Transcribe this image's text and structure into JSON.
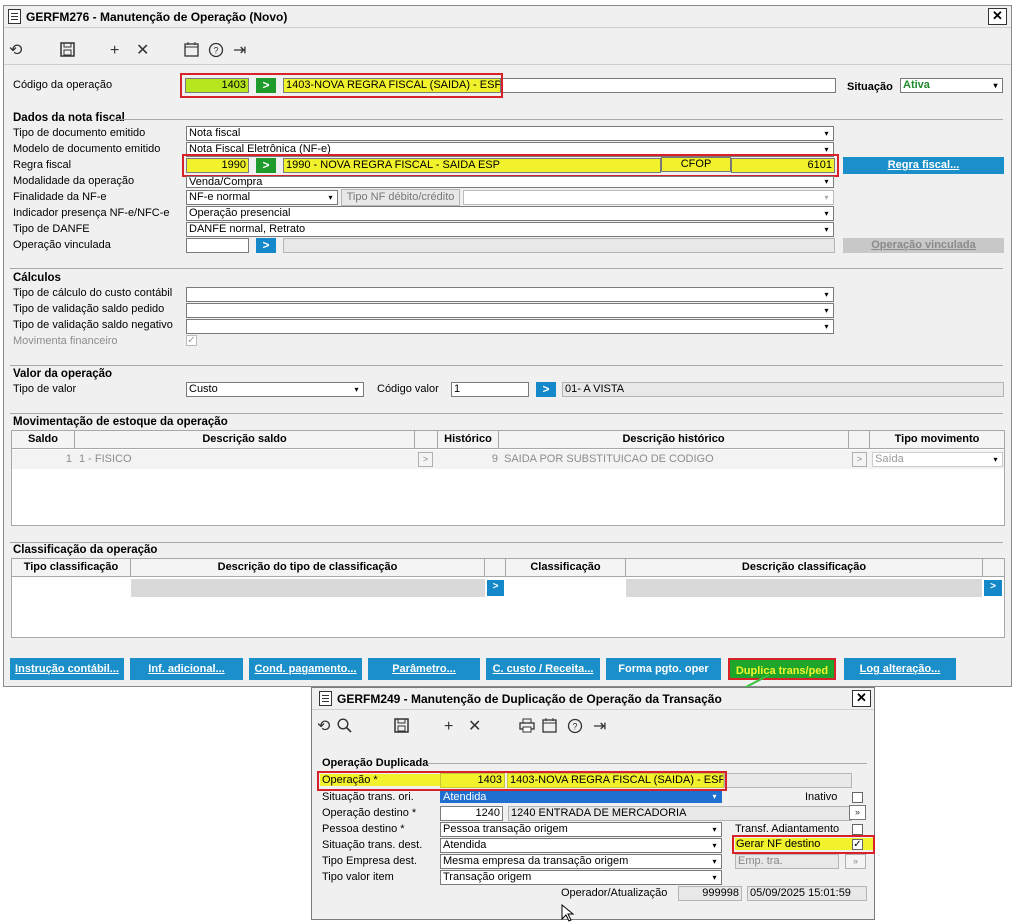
{
  "main": {
    "title": "GERFM276 - Manutenção de Operação (Novo)",
    "codigo_label": "Código da operação",
    "codigo_value": "1403",
    "codigo_desc": "1403-NOVA REGRA FISCAL (SAIDA) - ESP",
    "situacao_label": "Situação",
    "situacao_value": "Ativa",
    "section_nota": "Dados da nota fiscal",
    "tipo_doc_label": "Tipo de documento emitido",
    "tipo_doc_value": "Nota fiscal",
    "modelo_doc_label": "Modelo de documento emitido",
    "modelo_doc_value": "Nota Fiscal Eletrônica (NF-e)",
    "regra_label": "Regra fiscal",
    "regra_value": "1990",
    "regra_desc": "1990 - NOVA REGRA FISCAL - SAIDA ESP",
    "cfop_label": "CFOP",
    "cfop_value": "6101",
    "regra_btn": "Regra fiscal...",
    "modalidade_label": "Modalidade da operação",
    "modalidade_value": "Venda/Compra",
    "finalidade_label": "Finalidade da NF-e",
    "finalidade_value": "NF-e normal",
    "tipo_nf_btn": "Tipo NF débito/crédito",
    "indicador_label": "Indicador presença NF-e/NFC-e",
    "indicador_value": "Operação presencial",
    "danfe_label": "Tipo de DANFE",
    "danfe_value": "DANFE normal, Retrato",
    "op_vinculada_label": "Operação vinculada",
    "op_vinculada_btn": "Operação vinculada",
    "section_calculos": "Cálculos",
    "custo_label": "Tipo de cálculo do custo contábil",
    "saldo_pedido_label": "Tipo de validação saldo pedido",
    "saldo_negativo_label": "Tipo de validação saldo negativo",
    "mov_fin_label": "Movimenta financeiro",
    "section_valor": "Valor da operação",
    "tipo_valor_label": "Tipo de valor",
    "tipo_valor_value": "Custo",
    "codigo_valor_label": "Código valor",
    "codigo_valor_value": "1",
    "codigo_valor_desc": "01- A VISTA",
    "section_estoque": "Movimentação de estoque da operação",
    "estoque_headers": [
      "Saldo",
      "Descrição saldo",
      "Histórico",
      "Descrição histórico",
      "Tipo movimento"
    ],
    "estoque_row": {
      "saldo": "1",
      "descricao": "1 - FISICO",
      "historico": "9",
      "desc_historico": "SAIDA POR SUBSTITUICAO DE CODIGO",
      "tipo": "Saída"
    },
    "section_class": "Classificação da operação",
    "class_headers": [
      "Tipo classificação",
      "Descrição do tipo de classificação",
      "Classificação",
      "Descrição classificação"
    ],
    "buttons": [
      "Instrução contábil...",
      "Inf. adicional...",
      "Cond. pagamento...",
      "Parâmetro...",
      "C. custo / Receita...",
      "Forma pgto. oper",
      "Duplica trans/ped",
      "Log alteração..."
    ]
  },
  "dup": {
    "title": "GERFM249 - Manutenção de Duplicação de Operação da Transação",
    "section": "Operação Duplicada",
    "operacao_label": "Operação *",
    "operacao_value": "1403",
    "operacao_desc": "1403-NOVA REGRA FISCAL (SAIDA) - ESP",
    "sit_ori_label": "Situação trans. ori.",
    "sit_ori_value": "Atendida",
    "inativo_label": "Inativo",
    "op_destino_label": "Operação destino *",
    "op_destino_value": "1240",
    "op_destino_desc": "1240 ENTRADA DE MERCADORIA",
    "pessoa_label": "Pessoa destino *",
    "pessoa_value": "Pessoa transação origem",
    "transf_label": "Transf. Adiantamento",
    "sit_dest_label": "Situação trans. dest.",
    "sit_dest_value": "Atendida",
    "gerar_label": "Gerar NF destino",
    "tipo_emp_label": "Tipo Empresa dest.",
    "tipo_emp_value": "Mesma empresa da transação origem",
    "emp_tra_label": "Emp. tra.",
    "tipo_valor_label": "Tipo valor item",
    "tipo_valor_value": "Transação origem",
    "operador_label": "Operador/Atualização",
    "operador_value": "999998",
    "data_value": "05/09/2025 15:01:59"
  },
  "colors": {
    "accent": "#1b8fc9",
    "highlight": "#f2f22c",
    "highlight_green": "#b7e61e",
    "callout_red": "#d8222a",
    "arrow_green": "#38c33a"
  }
}
